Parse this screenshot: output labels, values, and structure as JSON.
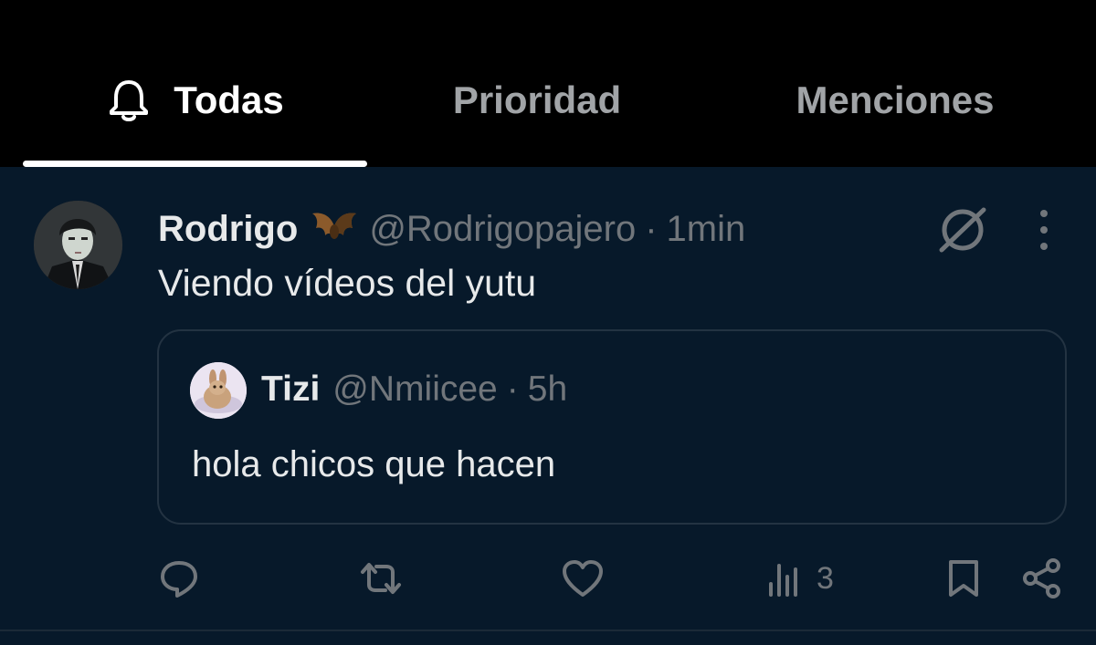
{
  "tabs": [
    {
      "label": "Todas",
      "active": true,
      "icon": "bell-icon"
    },
    {
      "label": "Prioridad",
      "active": false
    },
    {
      "label": "Menciones",
      "active": false
    }
  ],
  "post": {
    "author_name": "Rodrigo",
    "author_emoji": "bat",
    "author_handle": "@Rodrigopajero",
    "separator": "·",
    "time": "1min",
    "text": "Viendo vídeos del yutu",
    "quoted": {
      "name": "Tizi",
      "handle": "@Nmiicee",
      "separator": "·",
      "time": "5h",
      "text": "hola chicos que hacen"
    },
    "views": "3"
  },
  "colors": {
    "tab_bar_bg": "#000000",
    "post_bg": "#07192a",
    "primary_text": "#e7e9ea",
    "secondary_text": "#71767b",
    "inactive_tab": "#a1a4a7",
    "border": "#233342"
  }
}
